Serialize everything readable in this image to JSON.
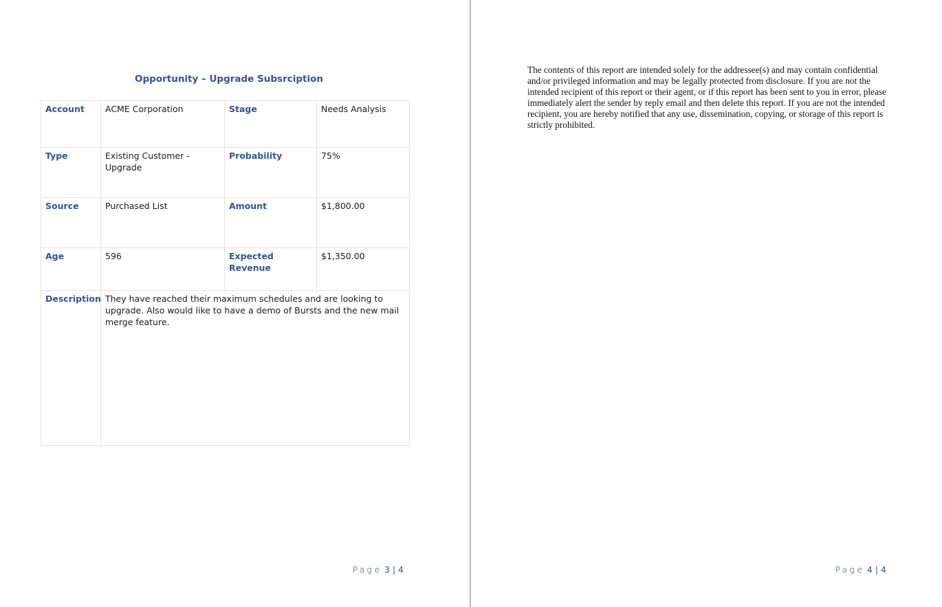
{
  "pages": [
    {
      "title": "Opportunity – Upgrade Subsrciption",
      "table": {
        "rows": [
          {
            "label1": "Account",
            "value1": "ACME Corporation",
            "label2": "Stage",
            "value2": "Needs Analysis"
          },
          {
            "label1": "Type",
            "value1": "Existing Customer - Upgrade",
            "label2": "Probability",
            "value2": "75%"
          },
          {
            "label1": "Source",
            "value1": "Purchased List",
            "label2": "Amount",
            "value2": "$1,800.00"
          },
          {
            "label1": "Age",
            "value1": "596",
            "label2": "Expected Revenue",
            "value2": "$1,350.00"
          }
        ],
        "description": {
          "label": "Description",
          "value": "They have reached their maximum schedules and are looking to upgrade. Also would like to have a demo of Bursts and the new mail merge feature."
        }
      },
      "footer": {
        "word": "Page",
        "number": "3",
        "separator": "|",
        "total": "4"
      }
    },
    {
      "disclaimer": "The contents of this report are intended solely for the addressee(s) and may contain confidential and/or privileged information and may be legally protected from disclosure. If you are not the intended recipient of this report or their agent, or if this report has been sent to you in error, please immediately alert the sender by reply email and then delete this report. If you are not the intended recipient, you are hereby notified that any use, dissemination, copying, or storage of this report is strictly prohibited.",
      "footer": {
        "word": "Page",
        "number": "4",
        "separator": "|",
        "total": "4"
      }
    }
  ]
}
